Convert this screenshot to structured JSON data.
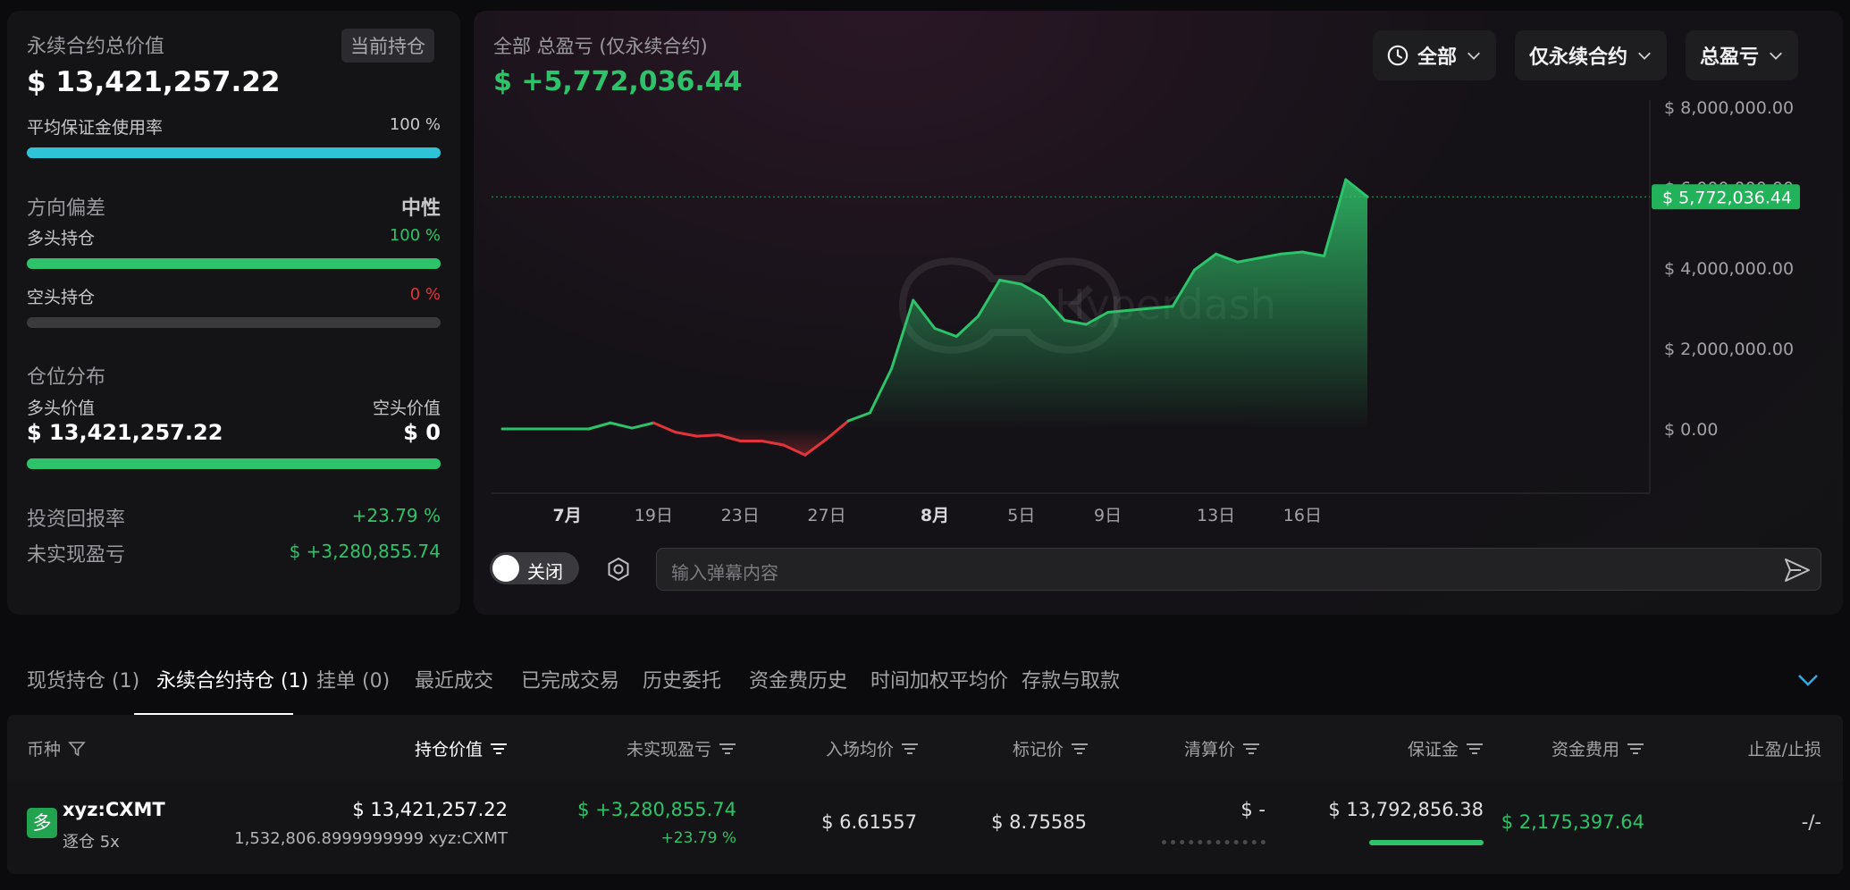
{
  "summary": {
    "title": "永续合约总价值",
    "position_chip": "当前持仓",
    "total_value": "$ 13,421,257.22",
    "margin_usage_label": "平均保证金使用率",
    "margin_usage_value": "100 %",
    "margin_usage_pct": 100,
    "bias_label": "方向偏差",
    "bias_value": "中性",
    "long_label": "多头持仓",
    "long_value": "100 %",
    "long_pct": 100,
    "short_label": "空头持仓",
    "short_value": "0 %",
    "short_pct": 0,
    "dist_label": "仓位分布",
    "long_value_label": "多头价值",
    "short_value_label": "空头价值",
    "long_amount": "$ 13,421,257.22",
    "short_amount": "$ 0",
    "dist_long_pct": 100,
    "roi_label": "投资回报率",
    "roi_value": "+23.79 %",
    "upnl_label": "未实现盈亏",
    "upnl_value": "$ +3,280,855.74"
  },
  "chart_header": {
    "subtitle": "全部 总盈亏 (仅永续合约)",
    "total_pnl": "$ +5,772,036.44",
    "dd_range": "全部",
    "dd_scope": "仅永续合约",
    "dd_metric": "总盈亏",
    "watermark": "Hyperdash"
  },
  "chart_data": {
    "type": "area",
    "title": "全部 总盈亏 (仅永续合约)",
    "ylabel": "",
    "xlabel": "",
    "ylim": [
      -1600000,
      8000000
    ],
    "y_ticks": [
      0,
      2000000,
      4000000,
      6000000,
      8000000
    ],
    "y_tick_labels": [
      "$ 0.00",
      "$ 2,000,000.00",
      "$ 4,000,000.00",
      "$ 6,000,000.00",
      "$ 8,000,000.00"
    ],
    "x_ticks": [
      "7月",
      "19日",
      "23日",
      "27日",
      "8月",
      "5日",
      "9日",
      "13日",
      "16日"
    ],
    "x_tick_bold": [
      true,
      false,
      false,
      false,
      true,
      false,
      false,
      false,
      false
    ],
    "x_tick_index": [
      3,
      7,
      11,
      15,
      20,
      24,
      28,
      33,
      37
    ],
    "current_value": 5772036.44,
    "current_label": "$ 5,772,036.44",
    "grid": false,
    "values": [
      0,
      0,
      0,
      0,
      0,
      150000,
      20000,
      150000,
      -80000,
      -180000,
      -150000,
      -300000,
      -300000,
      -400000,
      -650000,
      -250000,
      200000,
      400000,
      1500000,
      3200000,
      2500000,
      2300000,
      2800000,
      3700000,
      3600000,
      3300000,
      2700000,
      2600000,
      2900000,
      2950000,
      3000000,
      3050000,
      3950000,
      4350000,
      4150000,
      4250000,
      4350000,
      4400000,
      4300000,
      6200000,
      5772036.44
    ]
  },
  "danmaku": {
    "toggle_label": "关闭",
    "input_placeholder": "输入弹幕内容"
  },
  "tabs": [
    "现货持仓 (1)",
    "永续合约持仓 (1)",
    "挂单 (0)",
    "最近成交",
    "已完成交易",
    "历史委托",
    "资金费历史",
    "时间加权平均价",
    "存款与取款"
  ],
  "table": {
    "headers": {
      "coin": "币种",
      "position_value": "持仓价值",
      "upnl": "未实现盈亏",
      "entry": "入场均价",
      "mark": "标记价",
      "liq": "清算价",
      "margin": "保证金",
      "funding": "资金费用",
      "tpsl": "止盈/止损"
    },
    "row": {
      "side_badge": "多",
      "coin": "xyz:CXMT",
      "mode": "逐仓 5x",
      "position_value": "$ 13,421,257.22",
      "size": "1,532,806.8999999999 xyz:CXMT",
      "upnl": "$ +3,280,855.74",
      "upnl_pct": "+23.79 %",
      "entry": "$ 6.61557",
      "mark": "$ 8.75585",
      "liq": "$ -",
      "margin": "$ 13,792,856.38",
      "funding": "$ 2,175,397.64",
      "tpsl": "-/-"
    }
  },
  "colors": {
    "green": "#2ec36a",
    "red": "#e0353b",
    "cyan": "#2ec3d6"
  }
}
